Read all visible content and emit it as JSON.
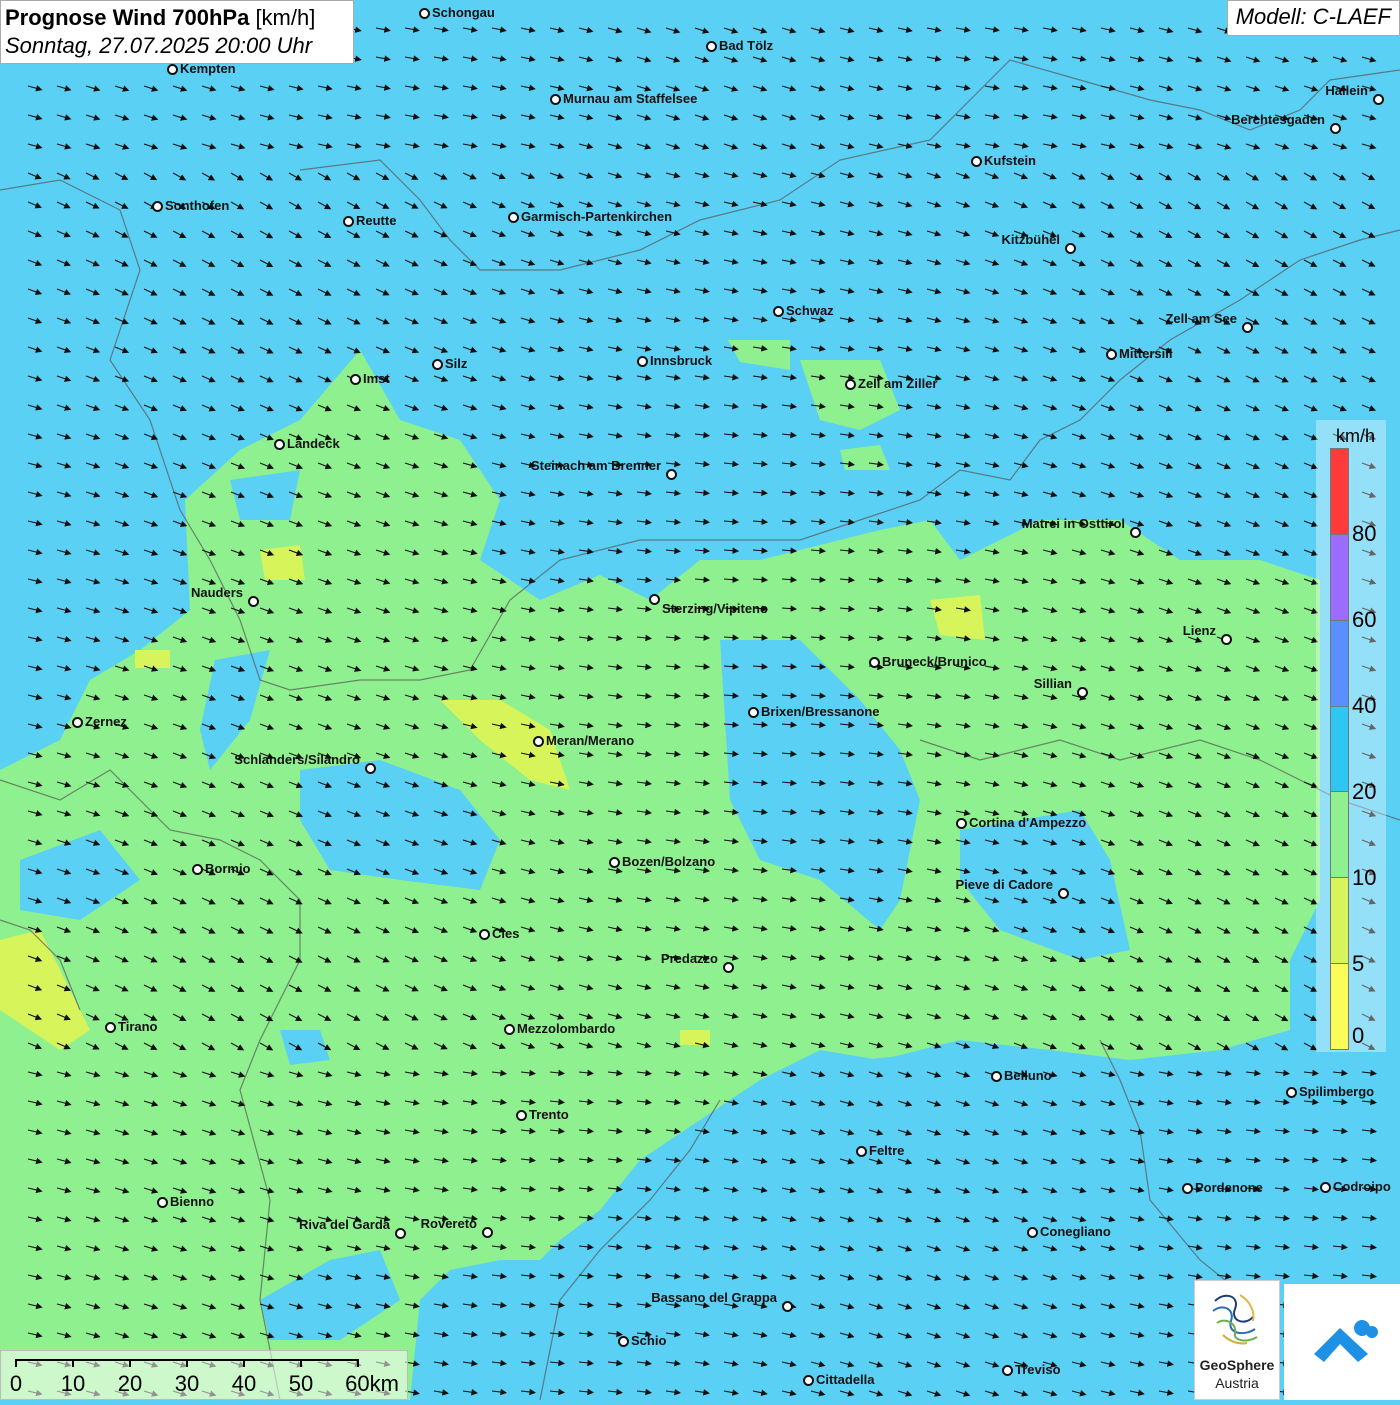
{
  "header": {
    "title_bold": "Prognose Wind 700hPa",
    "title_unit": "[km/h]",
    "date_line": "Sonntag, 27.07.2025 20:00 Uhr",
    "model": "Modell: C-LAEF"
  },
  "legend": {
    "unit": "km/h",
    "colors": [
      "#ff3b3b",
      "#9b6cff",
      "#5a8fff",
      "#2ec7f2",
      "#8ef08e",
      "#d7f55a",
      "#fbfb5a"
    ],
    "ticks": [
      "80",
      "60",
      "40",
      "20",
      "10",
      "5",
      "0"
    ]
  },
  "scalebar": {
    "labels": [
      "0",
      "10",
      "20",
      "30",
      "40",
      "50",
      "60km"
    ]
  },
  "logos": {
    "geosphere_line1": "GeoSphere",
    "geosphere_line2": "Austria"
  },
  "cities": [
    {
      "name": "Schongau"
    },
    {
      "name": "Bad Tölz"
    },
    {
      "name": "Kempten"
    },
    {
      "name": "Murnau am Staffelsee"
    },
    {
      "name": "Hallein"
    },
    {
      "name": "Berchtesgaden"
    },
    {
      "name": "Kufstein"
    },
    {
      "name": "Sonthofen"
    },
    {
      "name": "Reutte"
    },
    {
      "name": "Garmisch-Partenkirchen"
    },
    {
      "name": "Kitzbühel"
    },
    {
      "name": "Schwaz"
    },
    {
      "name": "Zell am See"
    },
    {
      "name": "Mittersill"
    },
    {
      "name": "Silz"
    },
    {
      "name": "Innsbruck"
    },
    {
      "name": "Imst"
    },
    {
      "name": "Zell am Ziller"
    },
    {
      "name": "Landeck"
    },
    {
      "name": "Steinach am Brenner"
    },
    {
      "name": "Matrei in Osttirol"
    },
    {
      "name": "Nauders"
    },
    {
      "name": "Sterzing/Vipiteno"
    },
    {
      "name": "Lienz"
    },
    {
      "name": "Bruneck/Brunico"
    },
    {
      "name": "Sillian"
    },
    {
      "name": "Brixen/Bressanone"
    },
    {
      "name": "Zernez"
    },
    {
      "name": "Meran/Merano"
    },
    {
      "name": "Schlanders/Silandro"
    },
    {
      "name": "Cortina d'Ampezzo"
    },
    {
      "name": "Bozen/Bolzano"
    },
    {
      "name": "Bormio"
    },
    {
      "name": "Pieve di Cadore"
    },
    {
      "name": "Cles"
    },
    {
      "name": "Predazzo"
    },
    {
      "name": "Tirano"
    },
    {
      "name": "Mezzolombardo"
    },
    {
      "name": "Belluno"
    },
    {
      "name": "Spilimbergo"
    },
    {
      "name": "Trento"
    },
    {
      "name": "Feltre"
    },
    {
      "name": "Pordenone"
    },
    {
      "name": "Codroipo"
    },
    {
      "name": "Bienno"
    },
    {
      "name": "Riva del Garda"
    },
    {
      "name": "Rovereto"
    },
    {
      "name": "Conegliano"
    },
    {
      "name": "Bassano del Grappa"
    },
    {
      "name": "Schio"
    },
    {
      "name": "Treviso"
    },
    {
      "name": "Cittadella"
    }
  ]
}
